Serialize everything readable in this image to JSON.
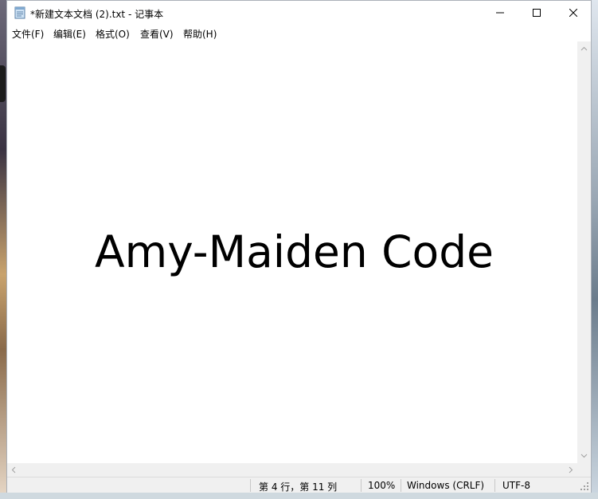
{
  "window": {
    "title": "*新建文本文档 (2).txt - 记事本",
    "app_icon": "notepad-icon"
  },
  "menu": {
    "items": [
      "文件(F)",
      "编辑(E)",
      "格式(O)",
      "查看(V)",
      "帮助(H)"
    ]
  },
  "editor": {
    "content": "Amy-Maiden Code"
  },
  "status": {
    "position": "第 4 行，第 11 列",
    "zoom": "100%",
    "line_ending": "Windows (CRLF)",
    "encoding": "UTF-8"
  },
  "colors": {
    "window_bg": "#ffffff",
    "chrome_bg": "#f0f0f0",
    "text": "#000000"
  }
}
